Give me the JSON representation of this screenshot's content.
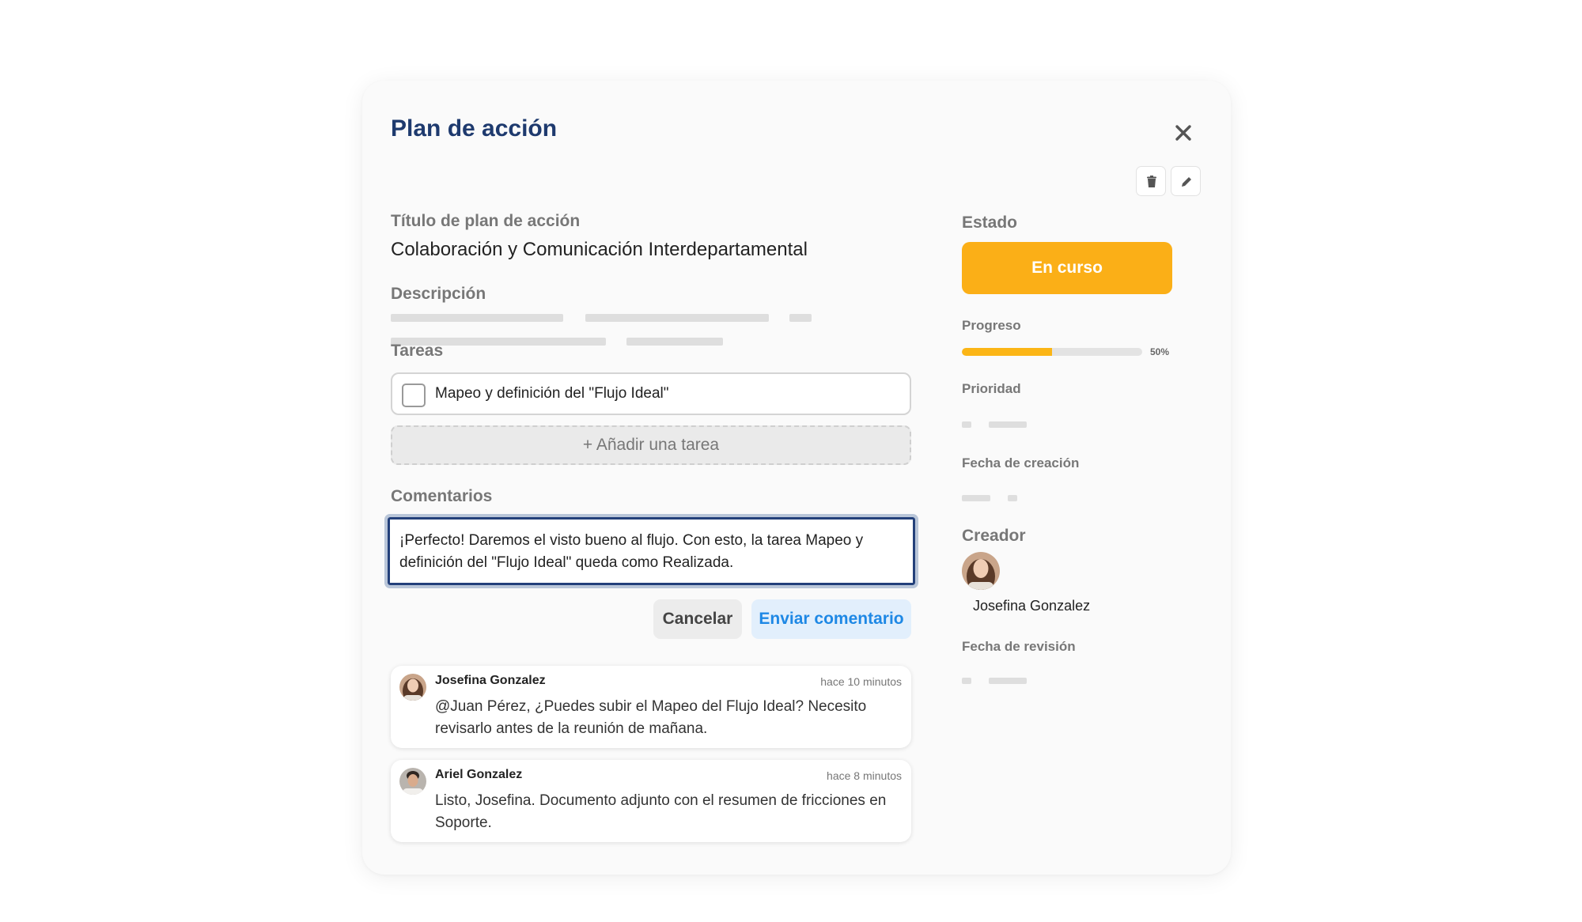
{
  "modal": {
    "title": "Plan de acción"
  },
  "plan": {
    "title_label": "Título de plan de acción",
    "title_value": "Colaboración y Comunicación Interdepartamental",
    "description_label": "Descripción"
  },
  "tasks": {
    "label": "Tareas",
    "items": [
      {
        "text": "Mapeo y definición del \"Flujo Ideal\"",
        "checked": false
      }
    ],
    "add_label": "+ Añadir una tarea"
  },
  "comments": {
    "label": "Comentarios",
    "input_value": "¡Perfecto! Daremos el visto bueno al flujo. Con esto, la tarea Mapeo y definición del \"Flujo Ideal\" queda como Realizada.",
    "cancel_label": "Cancelar",
    "send_label": "Enviar comentario",
    "list": [
      {
        "author": "Josefina  Gonzalez",
        "time": "hace 10 minutos",
        "text": "@Juan Pérez, ¿Puedes subir el Mapeo del Flujo Ideal? Necesito revisarlo antes de la reunión de mañana."
      },
      {
        "author": "Ariel Gonzalez",
        "time": "hace 8 minutos",
        "text": "Listo, Josefina. Documento adjunto con el resumen de fricciones en Soporte."
      }
    ]
  },
  "sidebar": {
    "status_label": "Estado",
    "status_value": "En curso",
    "status_color": "#FBAF17",
    "progress_label": "Progreso",
    "progress_value": 50,
    "progress_text": "50%",
    "priority_label": "Prioridad",
    "creation_date_label": "Fecha de creación",
    "creator_label": "Creador",
    "creator_name": "Josefina Gonzalez",
    "review_date_label": "Fecha de revisión"
  },
  "icons": {
    "close": "close-icon",
    "delete": "trash-icon",
    "edit": "pencil-icon"
  },
  "colors": {
    "title": "#1E3A6E",
    "accent_blue": "#1E88E5",
    "focus_border": "#23407A"
  }
}
